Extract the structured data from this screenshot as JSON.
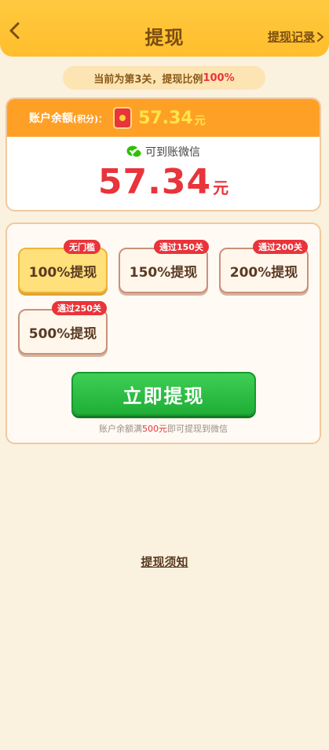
{
  "header": {
    "title": "提现",
    "record_label": "提现记录"
  },
  "level_info": {
    "prefix": "当前为第3关，提现比例",
    "ratio": "100%"
  },
  "balance": {
    "label": "账户余额",
    "label_suffix": "(积分)：",
    "amount": "57.34",
    "unit": "元",
    "wechat_text": "可到账微信",
    "big_amount": "57.34",
    "big_unit": "元"
  },
  "options": [
    {
      "label": "100%提现",
      "tag": "无门槛",
      "selected": true
    },
    {
      "label": "150%提现",
      "tag": "通过150关",
      "selected": false
    },
    {
      "label": "200%提现",
      "tag": "通过200关",
      "selected": false
    },
    {
      "label": "500%提现",
      "tag": "通过250关",
      "selected": false
    }
  ],
  "submit_label": "立即提现",
  "hint": {
    "prefix": "账户余额满",
    "amount": "500元",
    "suffix": "即可提现到微信"
  },
  "notice_label": "提现须知",
  "colors": {
    "header": "#ffbe2c",
    "accent_red": "#e8343a",
    "balance_bar": "#ffa026",
    "button_green": "#1fae36",
    "background": "#fbf1df"
  }
}
